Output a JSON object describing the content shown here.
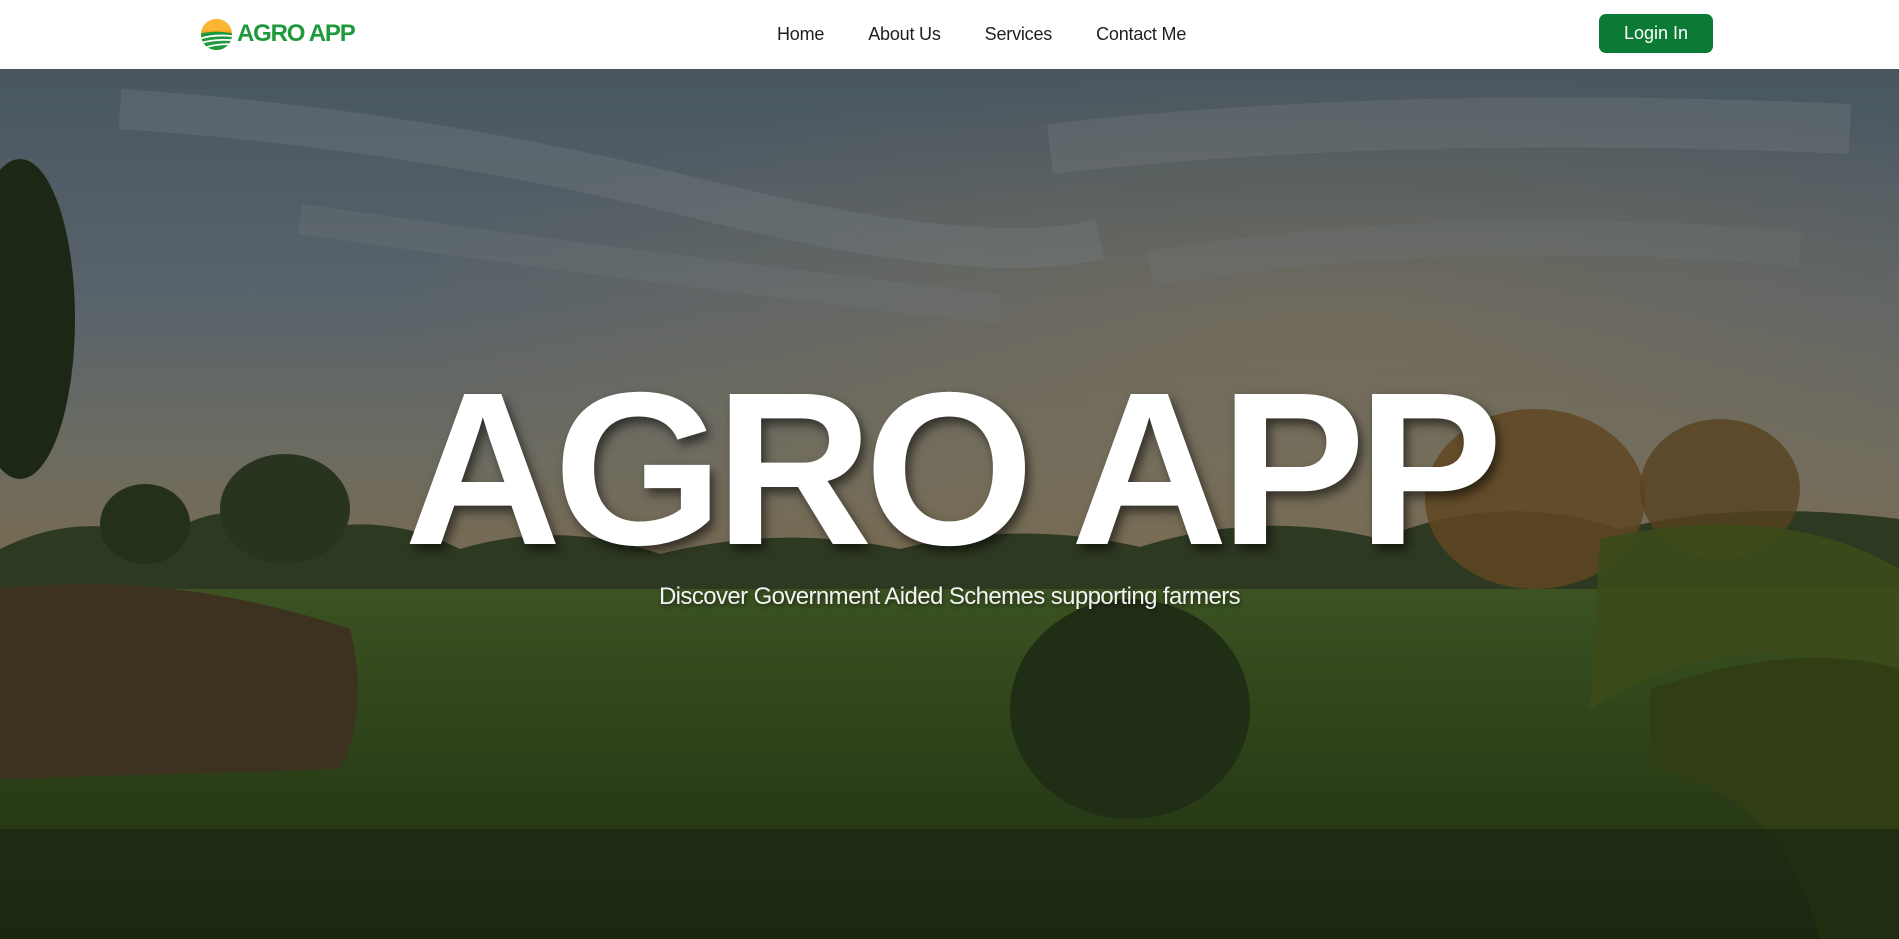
{
  "header": {
    "logo_text": "AGRO APP",
    "logo_icon": "sun-field-logo-icon",
    "nav": [
      {
        "label": "Home"
      },
      {
        "label": "About Us"
      },
      {
        "label": "Services"
      },
      {
        "label": "Contact Me"
      }
    ],
    "login_label": "Login In"
  },
  "hero": {
    "title": "AGRO APP",
    "subtitle": "Discover Government Aided Schemes supporting farmers",
    "background": "farmland-sunset-photo"
  },
  "colors": {
    "brand_green": "#1e9a3c",
    "button_green": "#0a7a35",
    "logo_sun": "#f5a623",
    "nav_text": "#1f1f1f",
    "header_bg": "#ffffff"
  }
}
